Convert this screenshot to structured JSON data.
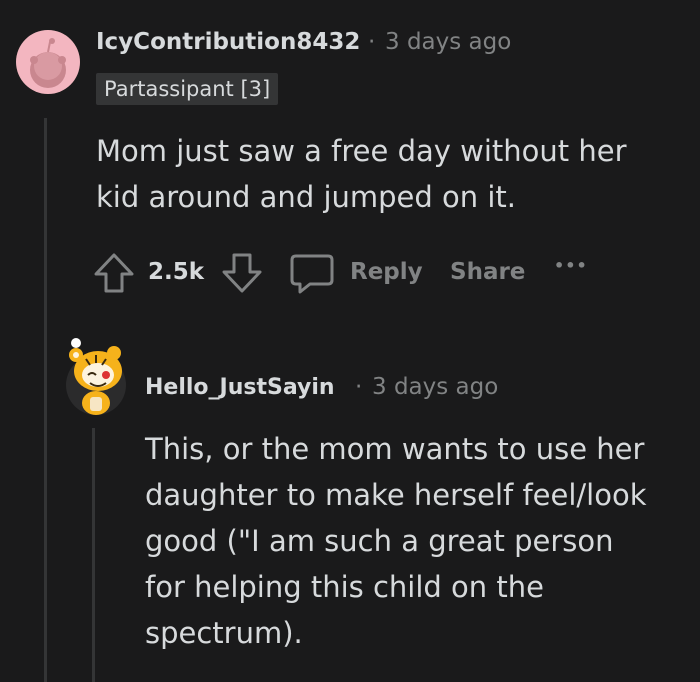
{
  "comment": {
    "username": "IcyContribution8432",
    "separator": "·",
    "time": "3 days ago",
    "flair": "Partassipant [3]",
    "body_lines": [
      "Mom just saw a free day without her",
      "kid around and jumped on it."
    ],
    "score": "2.5k",
    "reply_label": "Reply",
    "share_label": "Share",
    "more_label": "•••",
    "avatar_color": "#f3b6c0"
  },
  "reply": {
    "username": "Hello_JustSayin",
    "separator": "·",
    "time": "3 days ago",
    "body_lines": [
      "This, or the mom wants to use her",
      "daughter to make herself feel/look",
      "good (\"I am such a great person",
      "for helping this child on the",
      "spectrum)."
    ],
    "avatar_color": "#f6b21b"
  }
}
